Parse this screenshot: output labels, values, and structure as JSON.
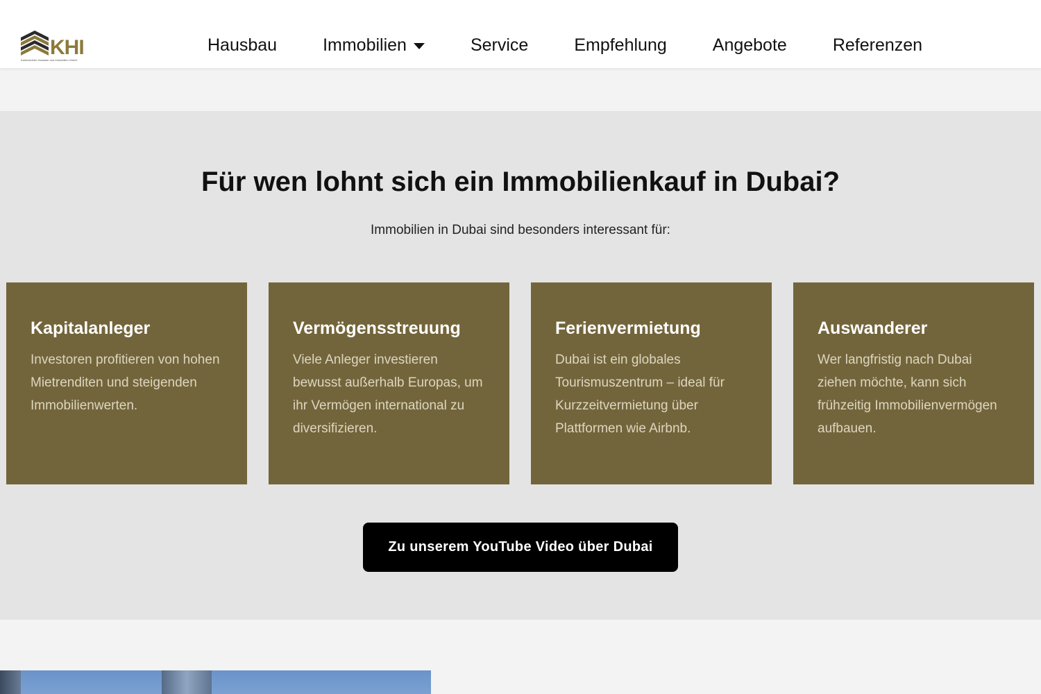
{
  "header": {
    "logo_text": "KHI",
    "logo_subtitle": "Kaiserstuhler Hausbau und Immobilien GmbH",
    "nav": [
      {
        "label": "Hausbau"
      },
      {
        "label": "Immobilien"
      },
      {
        "label": "Service"
      },
      {
        "label": "Empfehlung"
      },
      {
        "label": "Angebote"
      },
      {
        "label": "Referenzen"
      }
    ]
  },
  "section": {
    "heading": "Für wen lohnt sich ein Immobilienkauf in Dubai?",
    "subheading": "Immobilien in Dubai sind besonders interessant für:",
    "cards": [
      {
        "title": "Kapitalanleger",
        "text": "Investoren profitieren von hohen Mietrenditen und steigenden Immobilienwerten."
      },
      {
        "title": "Vermögensstreuung",
        "text": "Viele Anleger investieren bewusst außerhalb Europas, um ihr Vermögen international zu diversifizieren."
      },
      {
        "title": "Ferienvermietung",
        "text": "Dubai ist ein globales Tourismuszentrum – ideal für Kurzzeitvermietung über Plattformen wie Airbnb."
      },
      {
        "title": "Auswanderer",
        "text": "Wer langfristig nach Dubai ziehen möchte, kann sich frühzeitig Immobilienvermögen aufbauen."
      }
    ],
    "cta_label": "Zu unserem YouTube Video über Dubai"
  },
  "colors": {
    "card_bg": "#73653b",
    "band_bg": "#e4e4e4",
    "logo_gold": "#8c7a3c",
    "cta_bg": "#000000"
  }
}
